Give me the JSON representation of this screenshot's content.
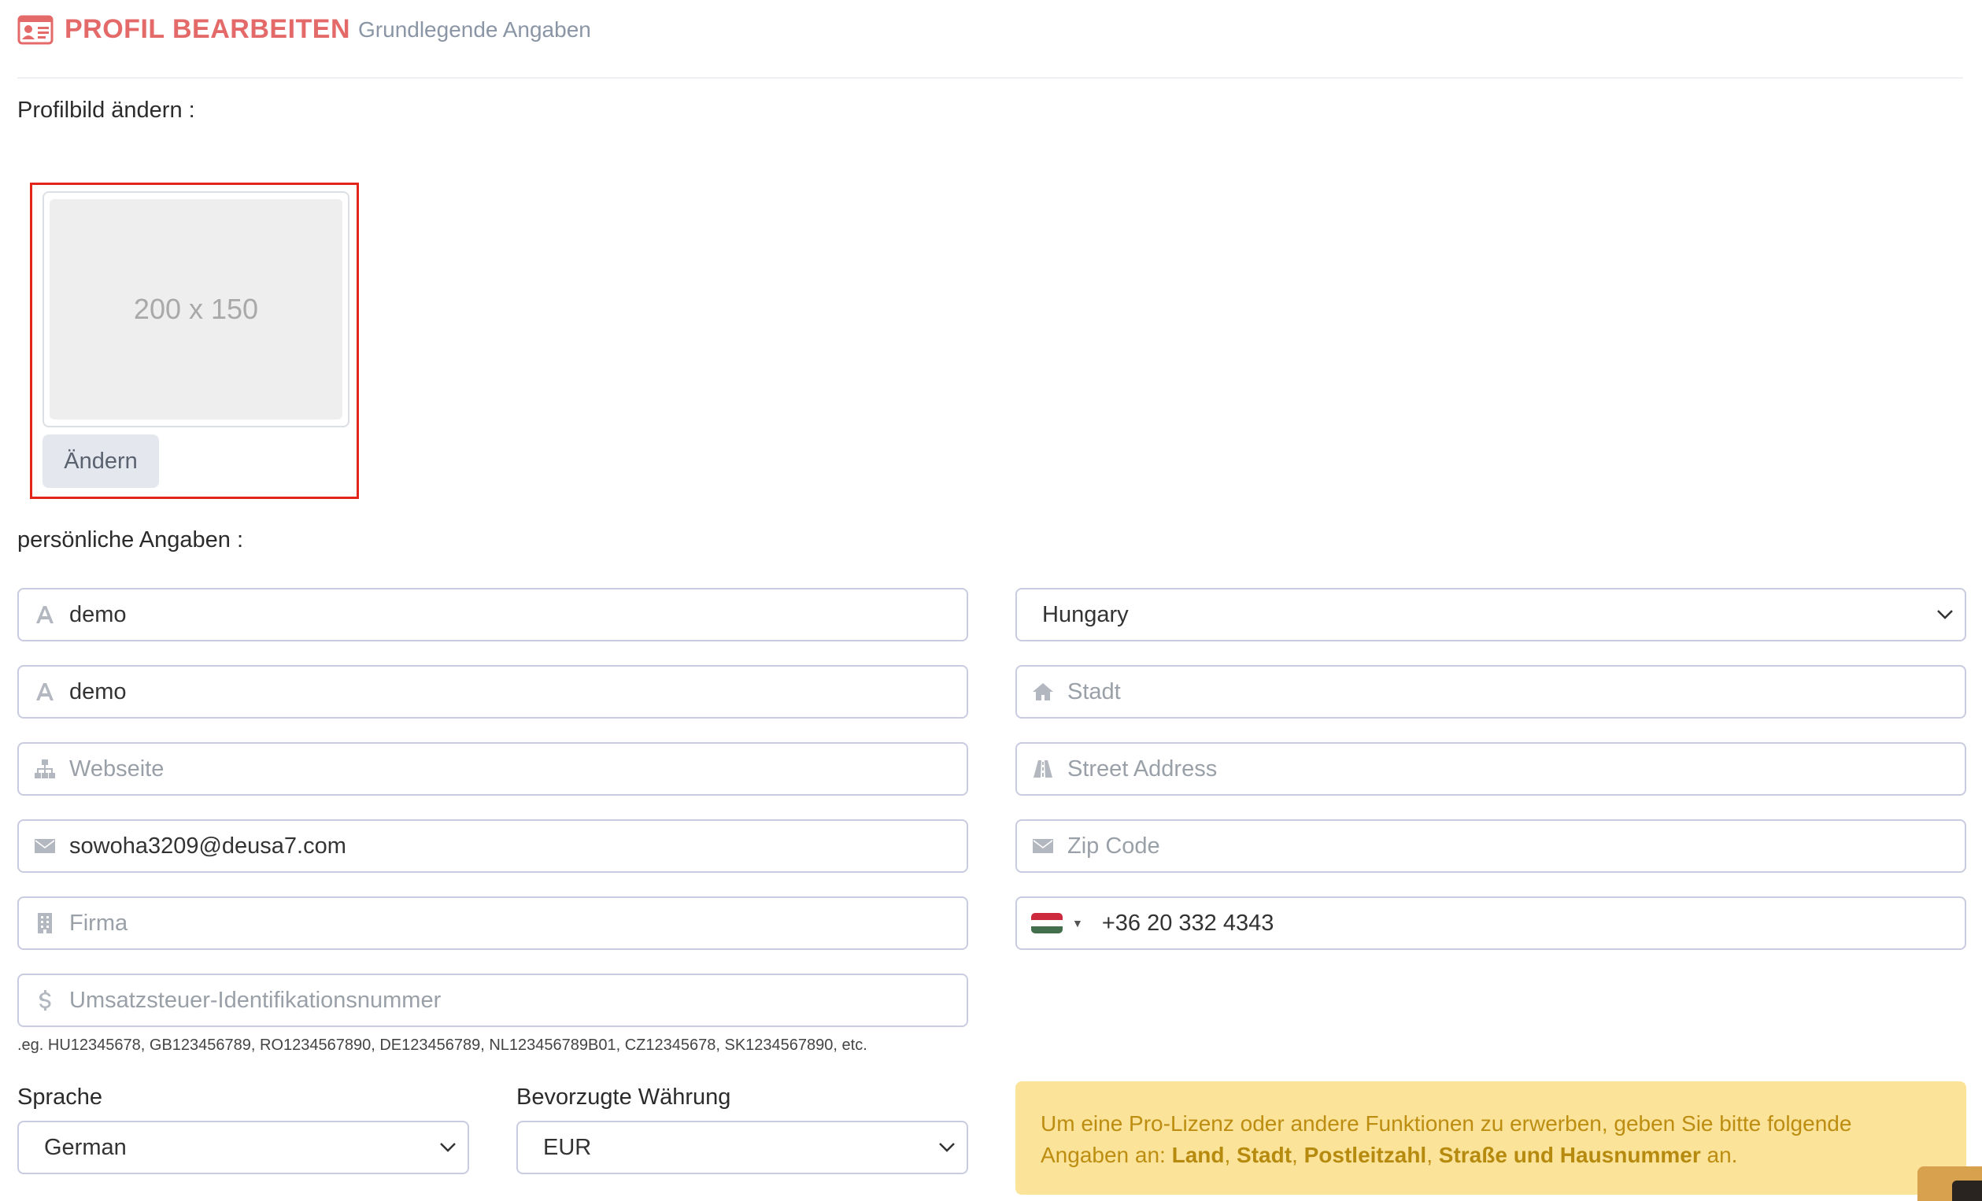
{
  "header": {
    "title": "PROFIL BEARBEITEN",
    "subtitle": "Grundlegende Angaben"
  },
  "profile_picture": {
    "label": "Profilbild ändern :",
    "placeholder_text": "200 x 150",
    "change_button": "Ändern"
  },
  "personal": {
    "label": "persönliche Angaben :",
    "first_name": {
      "value": "demo",
      "placeholder": ""
    },
    "last_name": {
      "value": "demo",
      "placeholder": ""
    },
    "website": {
      "value": "",
      "placeholder": "Webseite"
    },
    "email": {
      "value": "sowoha3209@deusa7.com",
      "placeholder": ""
    },
    "company": {
      "value": "",
      "placeholder": "Firma"
    },
    "vat": {
      "value": "",
      "placeholder": "Umsatzsteuer-Identifikationsnummer"
    },
    "vat_hint": ".eg. HU12345678, GB123456789, RO1234567890, DE123456789, NL123456789B01, CZ12345678, SK1234567890, etc."
  },
  "address": {
    "country": "Hungary",
    "city": {
      "value": "",
      "placeholder": "Stadt"
    },
    "street": {
      "value": "",
      "placeholder": "Street Address"
    },
    "zip": {
      "value": "",
      "placeholder": "Zip Code"
    },
    "phone": {
      "value": "+36 20 332 4343"
    }
  },
  "preferences": {
    "language_label": "Sprache",
    "language_value": "German",
    "currency_label": "Bevorzugte Währung",
    "currency_value": "EUR"
  },
  "notice": {
    "text_before": "Um eine Pro-Lizenz oder andere Funktionen zu erwerben, geben Sie bitte folgende Angaben an: ",
    "items": [
      "Land",
      "Stadt",
      "Postleitzahl",
      "Straße und Hausnummer"
    ],
    "sep_1": ", ",
    "sep_2": ", ",
    "sep_3": ", ",
    "text_after": " an."
  },
  "colors": {
    "accent": "#e46a6a",
    "highlight_border": "#e3241b",
    "notice_bg": "#fbe49a",
    "notice_text": "#bc8d10",
    "flag_red": "#cd2a3e",
    "flag_white": "#ffffff",
    "flag_green": "#436f4d"
  }
}
